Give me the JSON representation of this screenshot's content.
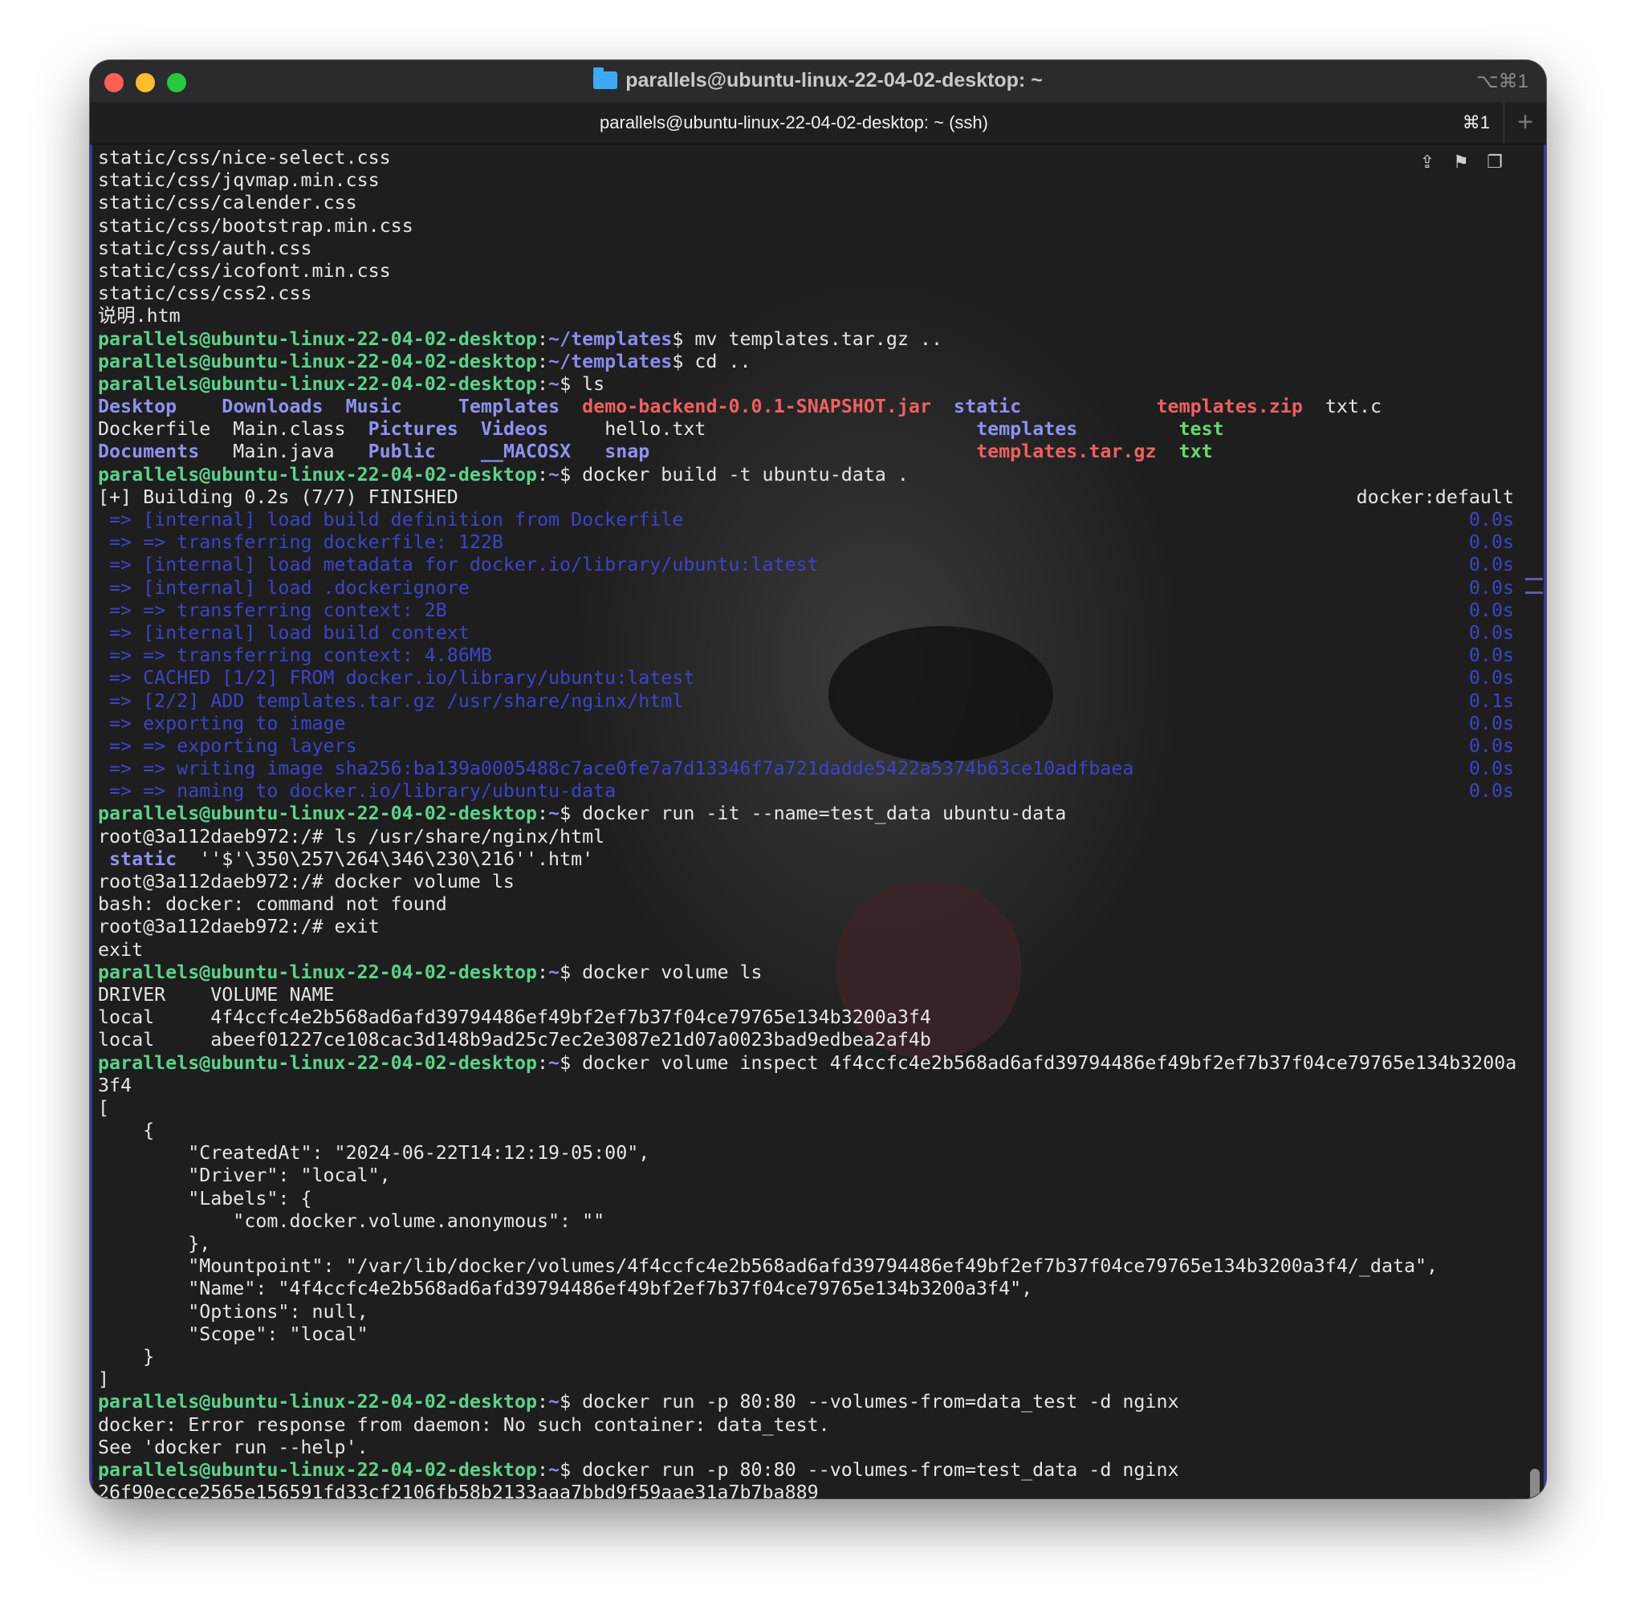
{
  "window": {
    "title": "parallels@ubuntu-linux-22-04-02-desktop: ~",
    "shortcut": "⌥⌘1",
    "tab_title": "parallels@ubuntu-linux-22-04-02-desktop: ~ (ssh)",
    "tab_shortcut": "⌘1",
    "new_tab": "+"
  },
  "icons": [
    "share-icon",
    "bookmark-icon",
    "copy-icon"
  ],
  "colors": {
    "prompt_user": "#5dd28a",
    "prompt_path": "#8a8cf0",
    "build_output": "#3d44c9",
    "archive": "#f06060",
    "executable": "#63dc6a"
  },
  "terminal": {
    "lines": [
      [
        {
          "t": "static/css/nice-select.css"
        }
      ],
      [
        {
          "t": "static/css/jqvmap.min.css"
        }
      ],
      [
        {
          "t": "static/css/calender.css"
        }
      ],
      [
        {
          "t": "static/css/bootstrap.min.css"
        }
      ],
      [
        {
          "t": "static/css/auth.css"
        }
      ],
      [
        {
          "t": "static/css/icofont.min.css"
        }
      ],
      [
        {
          "t": "static/css/css2.css"
        }
      ],
      [
        {
          "t": "说明.htm"
        }
      ],
      [
        {
          "t": "parallels@ubuntu-linux-22-04-02-desktop",
          "c": "green"
        },
        {
          "t": ":"
        },
        {
          "t": "~/templates",
          "c": "blue"
        },
        {
          "t": "$ mv templates.tar.gz .."
        }
      ],
      [
        {
          "t": "parallels@ubuntu-linux-22-04-02-desktop",
          "c": "green"
        },
        {
          "t": ":"
        },
        {
          "t": "~/templates",
          "c": "blue"
        },
        {
          "t": "$ cd .."
        }
      ],
      [
        {
          "t": "parallels@ubuntu-linux-22-04-02-desktop",
          "c": "green"
        },
        {
          "t": ":"
        },
        {
          "t": "~",
          "c": "blue"
        },
        {
          "t": "$ ls"
        }
      ],
      [
        {
          "t": "Desktop",
          "c": "dir"
        },
        {
          "t": "    "
        },
        {
          "t": "Downloads",
          "c": "dir"
        },
        {
          "t": "  "
        },
        {
          "t": "Music",
          "c": "dir"
        },
        {
          "t": "     "
        },
        {
          "t": "Templates",
          "c": "dir"
        },
        {
          "t": "  "
        },
        {
          "t": "demo-backend-0.0.1-SNAPSHOT.jar",
          "c": "red"
        },
        {
          "t": "  "
        },
        {
          "t": "static",
          "c": "dir"
        },
        {
          "t": "            "
        },
        {
          "t": "templates.zip",
          "c": "red"
        },
        {
          "t": "  txt.c"
        }
      ],
      [
        {
          "t": "Dockerfile  Main.class  "
        },
        {
          "t": "Pictures",
          "c": "dir"
        },
        {
          "t": "  "
        },
        {
          "t": "Videos",
          "c": "dir"
        },
        {
          "t": "     hello.txt                        "
        },
        {
          "t": "templates",
          "c": "dir"
        },
        {
          "t": "         "
        },
        {
          "t": "test",
          "c": "lime"
        }
      ],
      [
        {
          "t": "Documents",
          "c": "dir"
        },
        {
          "t": "   Main.java   "
        },
        {
          "t": "Public",
          "c": "dir"
        },
        {
          "t": "    "
        },
        {
          "t": "__MACOSX",
          "c": "dir"
        },
        {
          "t": "   "
        },
        {
          "t": "snap",
          "c": "dir"
        },
        {
          "t": "                             "
        },
        {
          "t": "templates.tar.gz",
          "c": "red"
        },
        {
          "t": "  "
        },
        {
          "t": "txt",
          "c": "lime"
        }
      ],
      [
        {
          "t": "parallels@ubuntu-linux-22-04-02-desktop",
          "c": "green"
        },
        {
          "t": ":"
        },
        {
          "t": "~",
          "c": "blue"
        },
        {
          "t": "$ docker build -t ubuntu-data ."
        }
      ],
      [
        {
          "t": "[+] Building 0.2s (7/7) FINISHED"
        }
      ],
      [
        {
          "t": " => [internal] load build definition from Dockerfile",
          "c": "build"
        }
      ],
      [
        {
          "t": " => => transferring dockerfile: 122B",
          "c": "build"
        }
      ],
      [
        {
          "t": " => [internal] load metadata for docker.io/library/ubuntu:latest",
          "c": "build"
        }
      ],
      [
        {
          "t": " => [internal] load .dockerignore",
          "c": "build"
        }
      ],
      [
        {
          "t": " => => transferring context: 2B",
          "c": "build"
        }
      ],
      [
        {
          "t": " => [internal] load build context",
          "c": "build"
        }
      ],
      [
        {
          "t": " => => transferring context: 4.86MB",
          "c": "build"
        }
      ],
      [
        {
          "t": " => CACHED [1/2] FROM docker.io/library/ubuntu:latest",
          "c": "build"
        }
      ],
      [
        {
          "t": " => [2/2] ADD templates.tar.gz /usr/share/nginx/html",
          "c": "build"
        }
      ],
      [
        {
          "t": " => exporting to image",
          "c": "build"
        }
      ],
      [
        {
          "t": " => => exporting layers",
          "c": "build"
        }
      ],
      [
        {
          "t": " => => writing image sha256:ba139a0005488c7ace0fe7a7d13346f7a721dadde5422a5374b63ce10adfbaea",
          "c": "build"
        }
      ],
      [
        {
          "t": " => => naming to docker.io/library/ubuntu-data",
          "c": "build"
        }
      ],
      [
        {
          "t": "parallels@ubuntu-linux-22-04-02-desktop",
          "c": "green"
        },
        {
          "t": ":"
        },
        {
          "t": "~",
          "c": "blue"
        },
        {
          "t": "$ docker run -it --name=test_data ubuntu-data"
        }
      ],
      [
        {
          "t": "root@3a112daeb972:/# ls /usr/share/nginx/html"
        }
      ],
      [
        {
          "t": " "
        },
        {
          "t": "static",
          "c": "dir"
        },
        {
          "t": "  ''$'\\350\\257\\264\\346\\230\\216''.htm'"
        }
      ],
      [
        {
          "t": "root@3a112daeb972:/# docker volume ls"
        }
      ],
      [
        {
          "t": "bash: docker: command not found"
        }
      ],
      [
        {
          "t": "root@3a112daeb972:/# exit"
        }
      ],
      [
        {
          "t": "exit"
        }
      ],
      [
        {
          "t": "parallels@ubuntu-linux-22-04-02-desktop",
          "c": "green"
        },
        {
          "t": ":"
        },
        {
          "t": "~",
          "c": "blue"
        },
        {
          "t": "$ docker volume ls"
        }
      ],
      [
        {
          "t": "DRIVER    VOLUME NAME"
        }
      ],
      [
        {
          "t": "local     4f4ccfc4e2b568ad6afd39794486ef49bf2ef7b37f04ce79765e134b3200a3f4"
        }
      ],
      [
        {
          "t": "local     abeef01227ce108cac3d148b9ad25c7ec2e3087e21d07a0023bad9edbea2af4b"
        }
      ],
      [
        {
          "t": "parallels@ubuntu-linux-22-04-02-desktop",
          "c": "green"
        },
        {
          "t": ":"
        },
        {
          "t": "~",
          "c": "blue"
        },
        {
          "t": "$ docker volume inspect 4f4ccfc4e2b568ad6afd39794486ef49bf2ef7b37f04ce79765e134b3200a"
        }
      ],
      [
        {
          "t": "3f4"
        }
      ],
      [
        {
          "t": "["
        }
      ],
      [
        {
          "t": "    {"
        }
      ],
      [
        {
          "t": "        \"CreatedAt\": \"2024-06-22T14:12:19-05:00\","
        }
      ],
      [
        {
          "t": "        \"Driver\": \"local\","
        }
      ],
      [
        {
          "t": "        \"Labels\": {"
        }
      ],
      [
        {
          "t": "            \"com.docker.volume.anonymous\": \"\""
        }
      ],
      [
        {
          "t": "        },"
        }
      ],
      [
        {
          "t": "        \"Mountpoint\": \"/var/lib/docker/volumes/4f4ccfc4e2b568ad6afd39794486ef49bf2ef7b37f04ce79765e134b3200a3f4/_data\","
        }
      ],
      [
        {
          "t": "        \"Name\": \"4f4ccfc4e2b568ad6afd39794486ef49bf2ef7b37f04ce79765e134b3200a3f4\","
        }
      ],
      [
        {
          "t": "        \"Options\": null,"
        }
      ],
      [
        {
          "t": "        \"Scope\": \"local\""
        }
      ],
      [
        {
          "t": "    }"
        }
      ],
      [
        {
          "t": "]"
        }
      ],
      [
        {
          "t": "parallels@ubuntu-linux-22-04-02-desktop",
          "c": "green"
        },
        {
          "t": ":"
        },
        {
          "t": "~",
          "c": "blue"
        },
        {
          "t": "$ docker run -p 80:80 --volumes-from=data_test -d nginx"
        }
      ],
      [
        {
          "t": "docker: Error response from daemon: No such container: data_test."
        }
      ],
      [
        {
          "t": "See 'docker run --help'."
        }
      ],
      [
        {
          "t": "parallels@ubuntu-linux-22-04-02-desktop",
          "c": "green"
        },
        {
          "t": ":"
        },
        {
          "t": "~",
          "c": "blue"
        },
        {
          "t": "$ docker run -p 80:80 --volumes-from=test_data -d nginx"
        }
      ],
      [
        {
          "t": "26f90ecce2565e156591fd33cf2106fb58b2133aaa7bbd9f59aae31a7b7ba889"
        }
      ]
    ],
    "right_annotations": [
      {
        "line": 15,
        "t": "docker:default",
        "c": ""
      },
      {
        "line": 16,
        "t": "0.0s",
        "c": "build"
      },
      {
        "line": 17,
        "t": "0.0s",
        "c": "build"
      },
      {
        "line": 18,
        "t": "0.0s",
        "c": "build"
      },
      {
        "line": 19,
        "t": "0.0s",
        "c": "build"
      },
      {
        "line": 20,
        "t": "0.0s",
        "c": "build"
      },
      {
        "line": 21,
        "t": "0.0s",
        "c": "build"
      },
      {
        "line": 22,
        "t": "0.0s",
        "c": "build"
      },
      {
        "line": 23,
        "t": "0.0s",
        "c": "build"
      },
      {
        "line": 24,
        "t": "0.1s",
        "c": "build"
      },
      {
        "line": 25,
        "t": "0.0s",
        "c": "build"
      },
      {
        "line": 26,
        "t": "0.0s",
        "c": "build"
      },
      {
        "line": 27,
        "t": "0.0s",
        "c": "build"
      },
      {
        "line": 28,
        "t": "0.0s",
        "c": "build"
      }
    ]
  }
}
